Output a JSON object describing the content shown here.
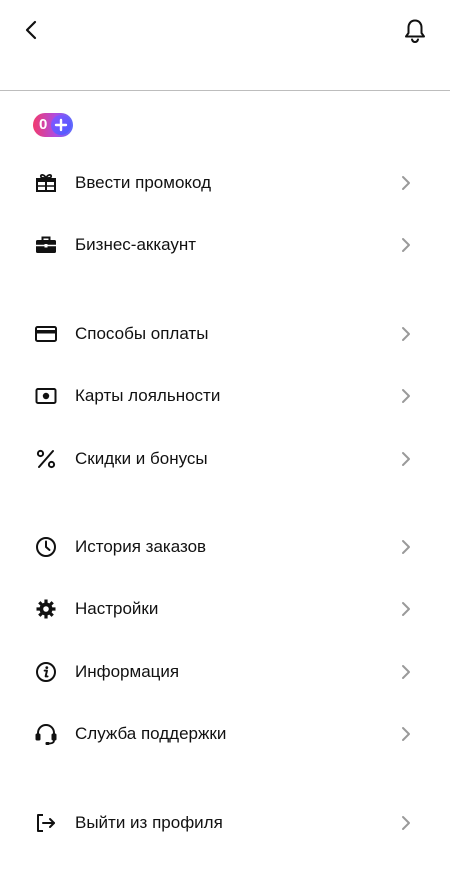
{
  "header": {
    "back_icon": "chevron-left-icon",
    "notifications_icon": "bell-icon"
  },
  "plus": {
    "points": "0",
    "icon": "plus-icon",
    "colors": [
      "#f23a6e",
      "#b24bdc",
      "#5a6bff"
    ]
  },
  "menu": {
    "items": [
      {
        "label": "Ввести промокод",
        "icon": "gift-icon"
      },
      {
        "label": "Бизнес-аккаунт",
        "icon": "briefcase-icon"
      },
      {
        "label": "Способы оплаты",
        "icon": "credit-card-icon"
      },
      {
        "label": "Карты лояльности",
        "icon": "loyalty-card-icon"
      },
      {
        "label": "Скидки и бонусы",
        "icon": "percent-icon"
      },
      {
        "label": "История заказов",
        "icon": "clock-icon"
      },
      {
        "label": "Настройки",
        "icon": "gear-icon"
      },
      {
        "label": "Информация",
        "icon": "info-icon"
      },
      {
        "label": "Служба поддержки",
        "icon": "headset-icon"
      },
      {
        "label": "Выйти из профиля",
        "icon": "logout-icon"
      }
    ],
    "chevron_icon": "chevron-right-icon"
  }
}
